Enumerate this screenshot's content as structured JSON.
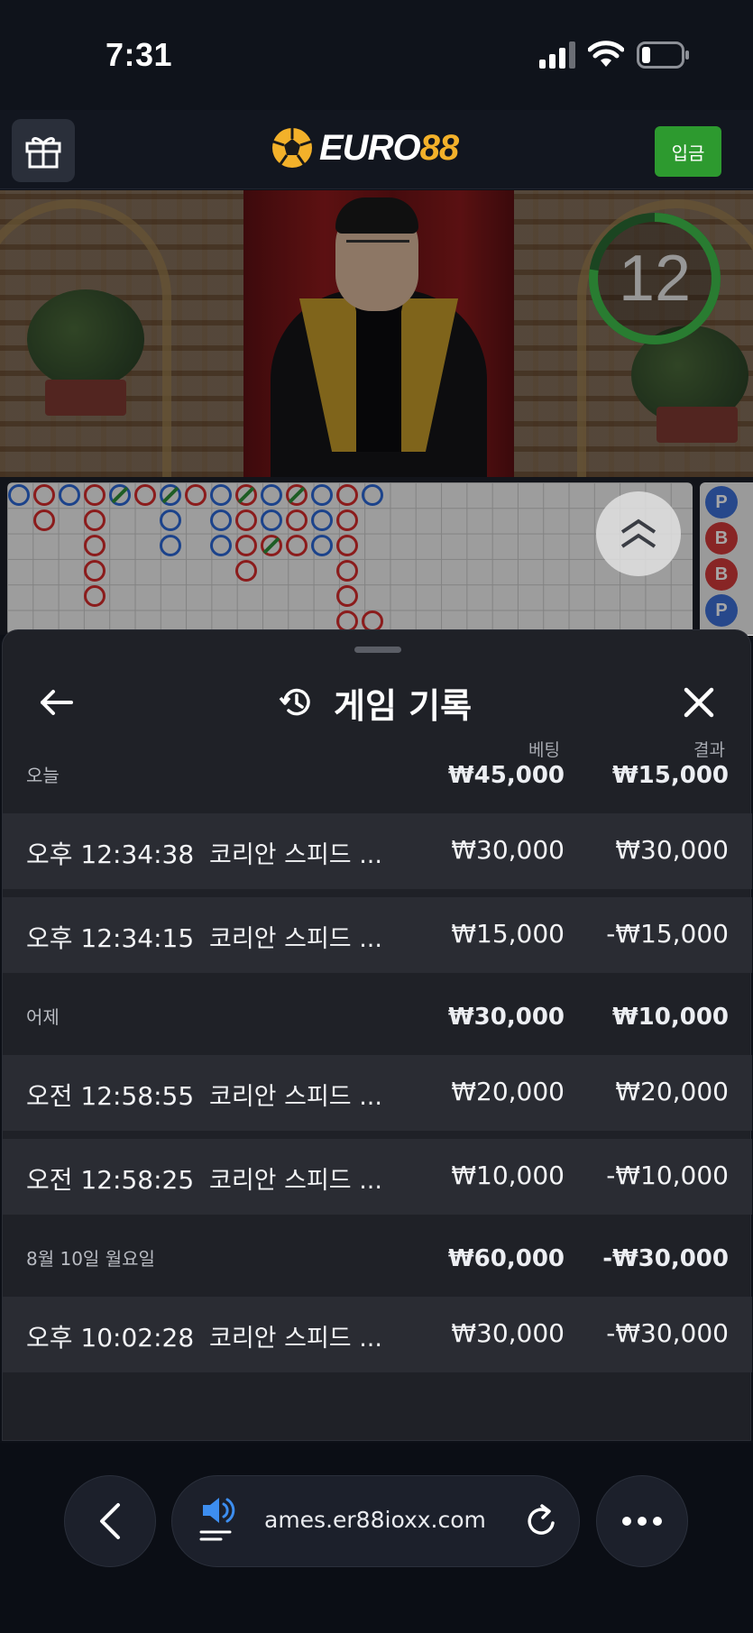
{
  "status_bar": {
    "time": "7:31"
  },
  "header": {
    "logo_white": "EURO",
    "logo_yellow": "88",
    "deposit_label": "입금"
  },
  "video": {
    "countdown": "12"
  },
  "roadmap": {
    "side_beads": [
      "P",
      "B",
      "B",
      "P"
    ]
  },
  "history": {
    "title": "게임 기록",
    "col_bet": "베팅",
    "col_result": "결과",
    "groups": [
      {
        "label": "오늘",
        "bet_total": "₩45,000",
        "result_total": "₩15,000",
        "rows": [
          {
            "time": "오후 12:34:38",
            "game": "코리안 스피드 ...",
            "bet": "₩30,000",
            "result": "₩30,000"
          },
          {
            "time": "오후 12:34:15",
            "game": "코리안 스피드 ...",
            "bet": "₩15,000",
            "result": "-₩15,000"
          }
        ]
      },
      {
        "label": "어제",
        "bet_total": "₩30,000",
        "result_total": "₩10,000",
        "rows": [
          {
            "time": "오전 12:58:55",
            "game": "코리안 스피드 ...",
            "bet": "₩20,000",
            "result": "₩20,000"
          },
          {
            "time": "오전 12:58:25",
            "game": "코리안 스피드 ...",
            "bet": "₩10,000",
            "result": "-₩10,000"
          }
        ]
      },
      {
        "label": "8월 10일 월요일",
        "bet_total": "₩60,000",
        "result_total": "-₩30,000",
        "rows": [
          {
            "time": "오후 10:02:28",
            "game": "코리안 스피드 ...",
            "bet": "₩30,000",
            "result": "-₩30,000"
          }
        ]
      }
    ]
  },
  "browser": {
    "url": "ames.er88ioxx.com"
  },
  "colors": {
    "accent_green": "#2d9a2f",
    "logo_gold": "#f3b12a",
    "player_blue": "#2c67d6",
    "banker_red": "#d62c2c"
  },
  "icons": [
    "gift-icon",
    "soccer-ball-icon",
    "history-icon",
    "back-arrow-icon",
    "close-icon",
    "chevrons-up-icon",
    "chevron-left-icon",
    "speaker-icon",
    "reload-icon",
    "more-icon"
  ]
}
